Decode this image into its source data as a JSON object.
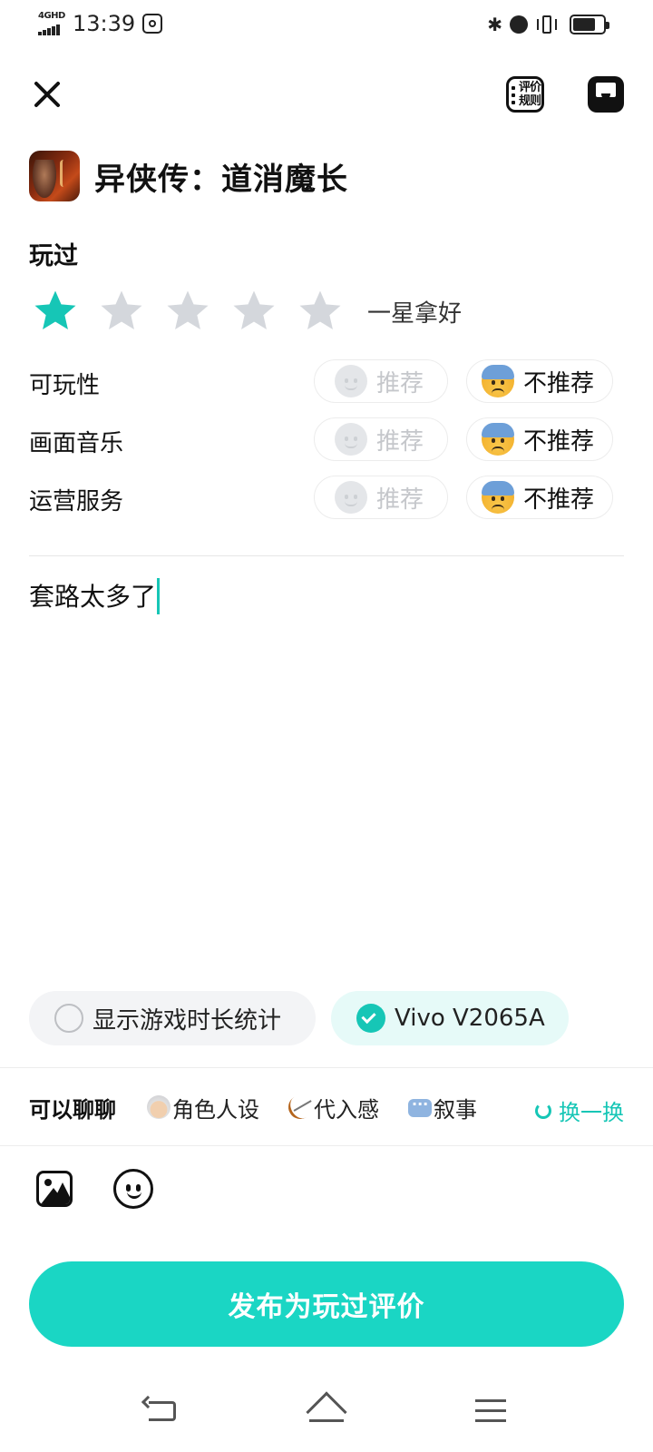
{
  "status_bar": {
    "network": "4GHD",
    "time": "13:39",
    "bluetooth_glyph": "✱"
  },
  "top_bar": {
    "rules_button_label": "评价\n规则"
  },
  "game": {
    "title": "异侠传：道消魔长"
  },
  "section_label": "玩过",
  "rating": {
    "value": 1,
    "max": 5,
    "text": "一星拿好",
    "active_color": "#16c6b6",
    "inactive_color": "#d4d7dc"
  },
  "aspects": [
    {
      "label": "可玩性",
      "recommend_label": "推荐",
      "not_recommend_label": "不推荐",
      "selected": "not_recommend"
    },
    {
      "label": "画面音乐",
      "recommend_label": "推荐",
      "not_recommend_label": "不推荐",
      "selected": "not_recommend"
    },
    {
      "label": "运营服务",
      "recommend_label": "推荐",
      "not_recommend_label": "不推荐",
      "selected": "not_recommend"
    }
  ],
  "review": {
    "text": "套路太多了"
  },
  "options": {
    "playtime_label": "显示游戏时长统计",
    "playtime_checked": false,
    "device_label": "Vivo V2065A",
    "device_checked": true
  },
  "topics": {
    "title": "可以聊聊",
    "items": [
      {
        "label": "角色人设",
        "icon": "person-emoji-icon"
      },
      {
        "label": "代入感",
        "icon": "bow-arrow-emoji-icon"
      },
      {
        "label": "叙事",
        "icon": "speech-bubble-emoji-icon"
      }
    ],
    "refresh_label": "换一换"
  },
  "publish_button": {
    "label": "发布为玩过评价",
    "color": "#1ad6c4"
  },
  "colors": {
    "accent": "#16c6b6"
  }
}
